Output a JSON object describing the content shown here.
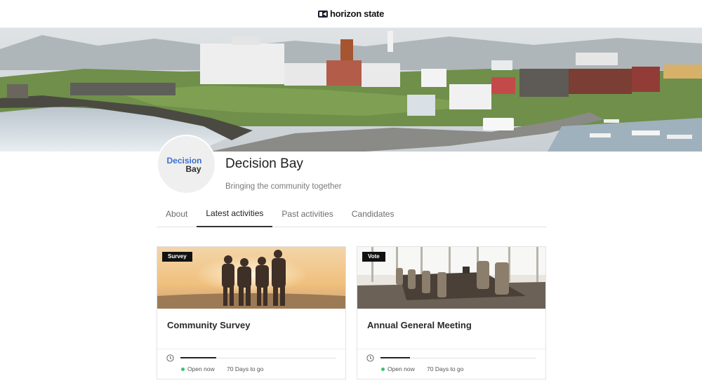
{
  "header": {
    "brand": "horizon state",
    "logo_icon": "horizon-state-logo-icon"
  },
  "hero": {
    "image": "harbor-town-landscape-photo"
  },
  "profile": {
    "avatar_line1": "Decision",
    "avatar_line2": "Bay",
    "name": "Decision Bay",
    "tagline": "Bringing the community together"
  },
  "tabs": [
    {
      "label": "About",
      "active": false
    },
    {
      "label": "Latest activities",
      "active": true
    },
    {
      "label": "Past activities",
      "active": false
    },
    {
      "label": "Candidates",
      "active": false
    }
  ],
  "cards": [
    {
      "badge": "Survey",
      "title": "Community Survey",
      "status": "Open now",
      "days": "70 Days to go",
      "progress": 0.23,
      "image": "friends-sunset-photo"
    },
    {
      "badge": "Vote",
      "title": "Annual General Meeting",
      "status": "Open now",
      "days": "70 Days to go",
      "progress": 0.19,
      "image": "boardroom-photo"
    }
  ],
  "colors": {
    "status_open": "#3cc36b",
    "avatar_accent": "#3b6fd4",
    "badge_bg": "#111111"
  }
}
